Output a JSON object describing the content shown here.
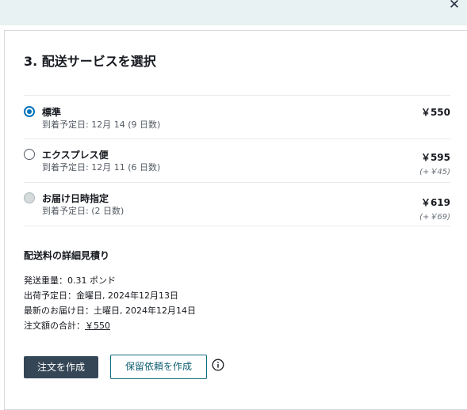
{
  "window": {
    "close_symbol": "✕"
  },
  "section": {
    "title": "3. 配送サービスを選択"
  },
  "options": [
    {
      "name": "標準",
      "date": "到着予定日: 12月 14 (9 日数)",
      "price": "￥550",
      "diff": "",
      "state": "checked"
    },
    {
      "name": "エクスプレス便",
      "date": "到着予定日: 12月 11 (6 日数)",
      "price": "￥595",
      "diff": "(+￥45)",
      "state": "unchecked"
    },
    {
      "name": "お届け日時指定",
      "date": "到着予定日: (2 日数)",
      "price": "￥619",
      "diff": "(+￥69)",
      "state": "disabled"
    }
  ],
  "estimate": {
    "title": "配送料の詳細見積り",
    "weight_label": "発送重量：",
    "weight_value": "0.31 ポンド",
    "ship_label": "出荷予定日：",
    "ship_value": "金曜日, 2024年12月13日",
    "latest_label": "最新のお届け日：",
    "latest_value": "土曜日, 2024年12月14日",
    "total_label": "注文額の合計：",
    "total_value": "￥550"
  },
  "actions": {
    "create_order": "注文を作成",
    "create_hold": "保留依頼を作成"
  },
  "colors": {
    "primary_button": "#354656",
    "accent": "#0073bb",
    "outline_button": "#0f6c80"
  }
}
